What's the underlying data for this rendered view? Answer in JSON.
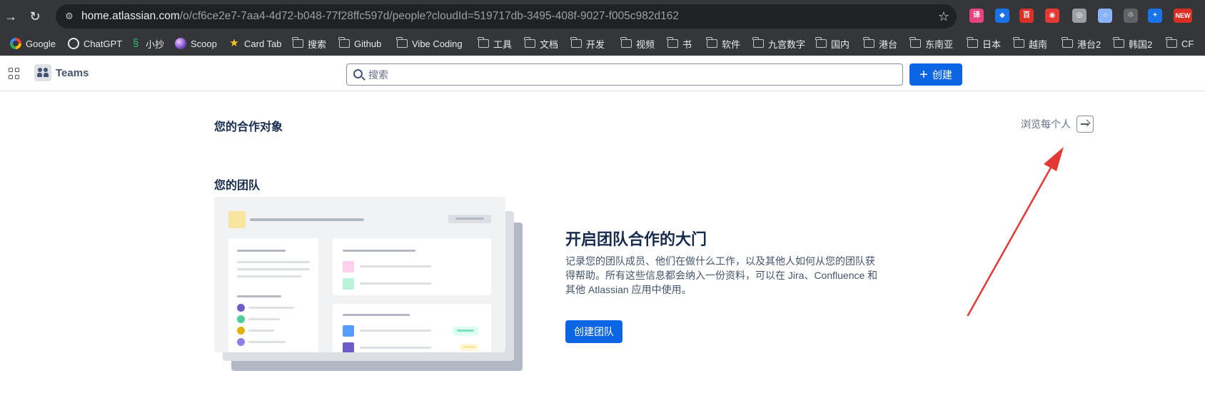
{
  "browser": {
    "url_host": "home.atlassian.com",
    "url_path": "/o/cf6ce2e7-7aa4-4d72-b048-77f28ffc597d/people?cloudId=519717db-3495-408f-9027-f005c982d162",
    "extensions": [
      {
        "name": "translate-ext-icon",
        "label": "译",
        "color": "#e8437b"
      },
      {
        "name": "diamond-ext-icon",
        "label": "◆",
        "color": "#1a73e8"
      },
      {
        "name": "red-ext-icon",
        "label": "百",
        "color": "#d93025"
      },
      {
        "name": "camera-red-ext-icon",
        "label": "◉",
        "color": "#e53935"
      },
      {
        "name": "camera-ext-icon",
        "label": "◎",
        "color": "#9aa0a6"
      },
      {
        "name": "ring-ext-icon",
        "label": "○",
        "color": "#8ab4f8"
      },
      {
        "name": "recycle-ext-icon",
        "label": "♲",
        "color": "#5f6368"
      },
      {
        "name": "plus-ext-icon",
        "label": "+",
        "color": "#1a73e8"
      },
      {
        "name": "new-ext-icon",
        "label": "NEW",
        "color": "#d93025"
      }
    ],
    "bookmarks": [
      {
        "label": "Google",
        "icon": "google-icon"
      },
      {
        "label": "ChatGPT",
        "icon": "chatgpt-icon"
      },
      {
        "label": "小抄",
        "icon": "xiaochao-icon"
      },
      {
        "label": "Scoop",
        "icon": "scoop-icon"
      },
      {
        "label": "Card Tab",
        "icon": "star-icon"
      },
      {
        "label": "搜索",
        "icon": "folder-icon"
      },
      {
        "label": "Github",
        "icon": "folder-icon"
      },
      {
        "label": "Vibe Coding",
        "icon": "folder-icon"
      },
      {
        "label": "工具",
        "icon": "folder-icon"
      },
      {
        "label": "文档",
        "icon": "folder-icon"
      },
      {
        "label": "开发",
        "icon": "folder-icon"
      },
      {
        "label": "视频",
        "icon": "folder-icon"
      },
      {
        "label": "书",
        "icon": "folder-icon"
      },
      {
        "label": "软件",
        "icon": "folder-icon"
      },
      {
        "label": "九宫数字",
        "icon": "folder-icon"
      },
      {
        "label": "国内",
        "icon": "folder-icon"
      },
      {
        "label": "港台",
        "icon": "folder-icon"
      },
      {
        "label": "东南亚",
        "icon": "folder-icon"
      },
      {
        "label": "日本",
        "icon": "folder-icon"
      },
      {
        "label": "越南",
        "icon": "folder-icon"
      },
      {
        "label": "港台2",
        "icon": "folder-icon"
      },
      {
        "label": "韩国2",
        "icon": "folder-icon"
      },
      {
        "label": "CF",
        "icon": "folder-icon"
      }
    ]
  },
  "app": {
    "product_name": "Teams",
    "search_placeholder": "搜索",
    "create_label": "创建"
  },
  "collaborators": {
    "title": "您的合作对象",
    "browse_label": "浏览每个人"
  },
  "teams": {
    "title": "您的团队",
    "cta_title": "开启团队合作的大门",
    "cta_description": "记录您的团队成员、他们在做什么工作，以及其他人如何从您的团队获得帮助。所有这些信息都会纳入一份资料，可以在 Jira、Confluence 和其他 Atlassian 应用中使用。",
    "create_team_label": "创建团队"
  },
  "colors": {
    "primary": "#0c66e4",
    "annotation_arrow": "#e53935"
  }
}
